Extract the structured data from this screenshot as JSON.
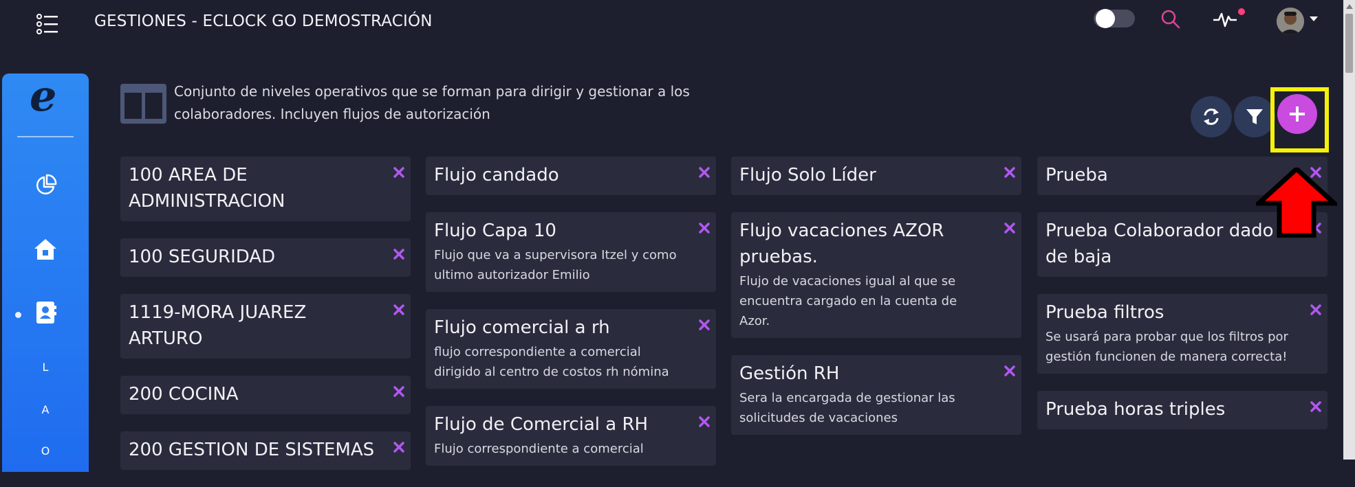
{
  "header": {
    "app_title": "GESTIONES - ECLOCK GO DEMOSTRACIÓN"
  },
  "top_icons": [
    "menu-icon",
    "theme-toggle",
    "search-icon",
    "pulse-icon",
    "avatar"
  ],
  "sidebar": {
    "logo": "e",
    "letters": [
      "L",
      "A",
      "O"
    ]
  },
  "page": {
    "description_line1": "Conjunto de niveles operativos que se forman para dirigir y gestionar a los",
    "description_line2": "colaboradores. Incluyen flujos de autorización",
    "add_label": "+"
  },
  "columns": [
    [
      {
        "title": "100 AREA DE ADMINISTRACION",
        "desc": ""
      },
      {
        "title": "100 SEGURIDAD",
        "desc": ""
      },
      {
        "title": "1119-MORA JUAREZ ARTURO",
        "desc": ""
      },
      {
        "title": "200 COCINA",
        "desc": ""
      },
      {
        "title": "200 GESTION DE SISTEMAS",
        "desc": ""
      }
    ],
    [
      {
        "title": "Flujo candado",
        "desc": ""
      },
      {
        "title": "Flujo Capa 10",
        "desc": "Flujo que va a supervisora Itzel y como ultimo autorizador Emilio"
      },
      {
        "title": "Flujo comercial a rh",
        "desc": "flujo correspondiente a comercial dirigido al centro de costos rh nómina"
      },
      {
        "title": "Flujo de Comercial a RH",
        "desc": "Flujo correspondiente a comercial"
      }
    ],
    [
      {
        "title": "Flujo Solo Líder",
        "desc": ""
      },
      {
        "title": "Flujo vacaciones AZOR pruebas.",
        "desc": "Flujo de vacaciones igual al que se encuentra cargado en la cuenta de Azor."
      },
      {
        "title": "Gestión RH",
        "desc": "Sera la encargada de gestionar las solicitudes de vacaciones"
      }
    ],
    [
      {
        "title": "Prueba",
        "desc": ""
      },
      {
        "title": "Prueba Colaborador dado de baja",
        "desc": ""
      },
      {
        "title": "Prueba filtros",
        "desc": "Se usará para probar que los filtros por gestión funcionen de manera correcta!"
      },
      {
        "title": "Prueba horas triples",
        "desc": ""
      }
    ]
  ],
  "colors": {
    "background": "#1e1f2e",
    "card": "#2a2c3d",
    "accent_add": "#c94be0",
    "close_x": "#b257f0",
    "sidebar": "#2f8af3",
    "highlight": "#f5f00c",
    "annotation_arrow": "#ff0000"
  }
}
